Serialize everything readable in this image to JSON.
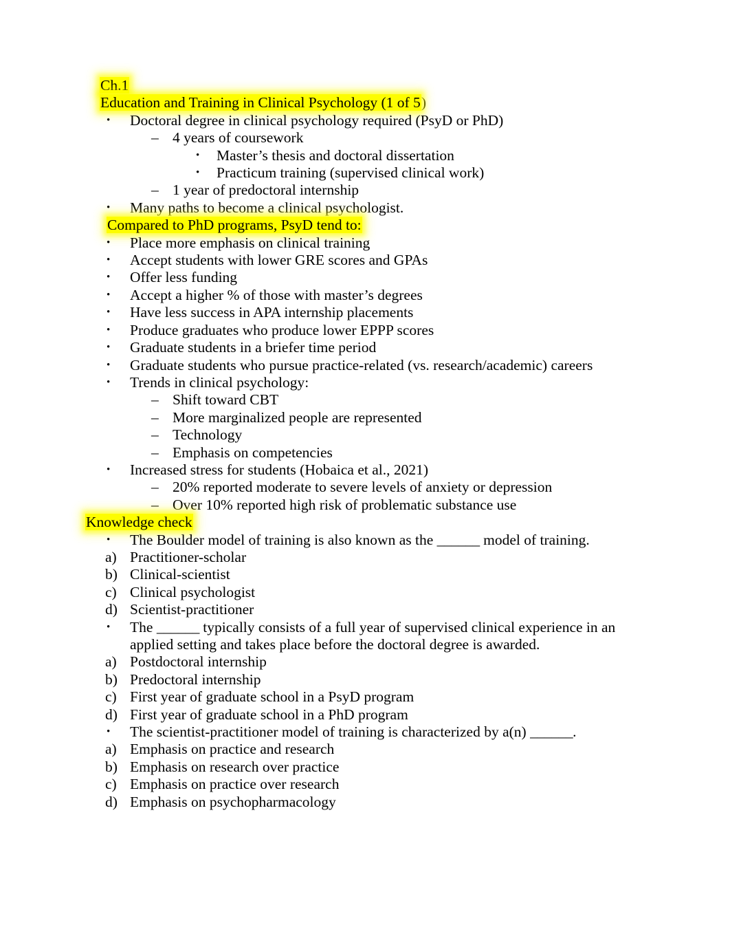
{
  "document": {
    "highlight_color": "#fdfd00",
    "text_color": "#000000",
    "background_color": "#ffffff",
    "chapter_label": "Ch.1",
    "slide_title": "Education and Training in Clinical Psychology (1 of 5",
    "slide_title_tail": ")",
    "sections": [
      {
        "id": "education-and-training",
        "items": [
          {
            "level": 1,
            "marker": "•",
            "text": "Doctoral degree in clinical psychology required (PsyD or PhD)"
          },
          {
            "level": 2,
            "marker": "–",
            "text": "4 years of coursework"
          },
          {
            "level": 3,
            "marker": "•",
            "text": "Master’s thesis and doctoral dissertation"
          },
          {
            "level": 3,
            "marker": "•",
            "text": "Practicum training (supervised clinical work)"
          },
          {
            "level": 2,
            "marker": "–",
            "text": "1 year of predoctoral internship"
          },
          {
            "level": 1,
            "marker": "•",
            "text": "Many paths to become a clinical psychologist."
          }
        ]
      },
      {
        "id": "psyd-vs-phd",
        "heading": "Compared to PhD programs, PsyD tend to:",
        "heading_highlighted": true,
        "items": [
          {
            "level": 1,
            "marker": "•",
            "text": "Place more emphasis on clinical training"
          },
          {
            "level": 1,
            "marker": "•",
            "text": "Accept students with lower GRE scores and GPAs"
          },
          {
            "level": 1,
            "marker": "•",
            "text": "Offer less funding"
          },
          {
            "level": 1,
            "marker": "•",
            "text": "Accept a higher % of those with master’s degrees"
          },
          {
            "level": 1,
            "marker": "•",
            "text": "Have less success in APA internship placements"
          },
          {
            "level": 1,
            "marker": "•",
            "text": "Produce graduates who produce lower EPPP scores"
          },
          {
            "level": 1,
            "marker": "•",
            "text": "Graduate students in a briefer time period"
          },
          {
            "level": 1,
            "marker": "•",
            "text": "Graduate students who pursue practice-related (vs. research/academic) careers"
          },
          {
            "level": 1,
            "marker": "•",
            "text": "Trends in clinical psychology:"
          },
          {
            "level": 2,
            "marker": "–",
            "text": "Shift toward CBT"
          },
          {
            "level": 2,
            "marker": "–",
            "text": "More marginalized people are represented"
          },
          {
            "level": 2,
            "marker": "–",
            "text": "Technology"
          },
          {
            "level": 2,
            "marker": "–",
            "text": "Emphasis on competencies"
          },
          {
            "level": 1,
            "marker": "•",
            "text": "Increased stress for students (Hobaica et al., 2021)"
          },
          {
            "level": 2,
            "marker": "–",
            "text": "20% reported moderate to severe levels of anxiety or depression"
          },
          {
            "level": 2,
            "marker": "–",
            "text": "Over 10% reported high risk of problematic substance use"
          }
        ]
      }
    ],
    "knowledge_check": {
      "heading": "Knowledge check",
      "heading_highlighted": true,
      "questions": [
        {
          "marker": "•",
          "prompt_before": "The Boulder model of training is also known as the ",
          "blank": "______",
          "prompt_after": " model of training.",
          "options": [
            {
              "marker": "a)",
              "text": "Practitioner-scholar"
            },
            {
              "marker": "b)",
              "text": "Clinical-scientist"
            },
            {
              "marker": "c)",
              "text": "Clinical psychologist"
            },
            {
              "marker": "d)",
              "text": "Scientist-practitioner"
            }
          ]
        },
        {
          "marker": "•",
          "prompt_before": "The ",
          "blank": "______",
          "prompt_after": " typically consists of a full year of supervised clinical experience in an applied setting and takes place before the doctoral degree is awarded.",
          "options": [
            {
              "marker": "a)",
              "text": "Postdoctoral internship"
            },
            {
              "marker": "b)",
              "text": "Predoctoral internship"
            },
            {
              "marker": "c)",
              "text": "First year of graduate school in a PsyD program"
            },
            {
              "marker": "d)",
              "text": "First year of graduate school in a PhD program"
            }
          ]
        },
        {
          "marker": "•",
          "prompt_before": "The scientist-practitioner model of training is characterized by a(n) ",
          "blank": "______",
          "prompt_after": ".",
          "options": [
            {
              "marker": "a)",
              "text": "Emphasis on practice and research"
            },
            {
              "marker": "b)",
              "text": "Emphasis on research over practice"
            },
            {
              "marker": "c)",
              "text": "Emphasis on practice over research"
            },
            {
              "marker": "d)",
              "text": "Emphasis on psychopharmacology"
            }
          ]
        }
      ]
    }
  }
}
